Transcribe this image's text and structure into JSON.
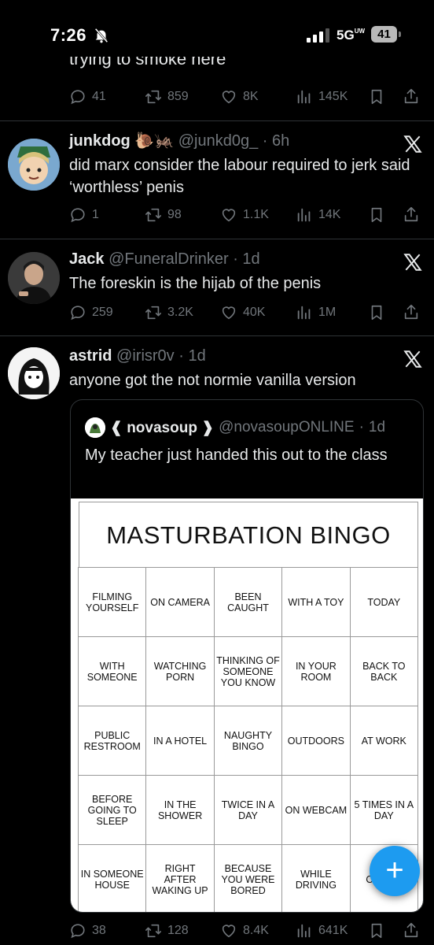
{
  "status": {
    "time": "7:26",
    "network": "5G",
    "network_sup": "UW",
    "battery": "41"
  },
  "prev_tweet": {
    "text_tail": "trying to smoke here",
    "replies": "41",
    "retweets": "859",
    "likes": "8K",
    "views": "145K"
  },
  "tweets": [
    {
      "name": "junkdog",
      "emoji": "🐌🦗",
      "handle": "@junkd0g_",
      "time": "6h",
      "text": "did marx consider the labour required to jerk said ‘worthless’ penis",
      "replies": "1",
      "retweets": "98",
      "likes": "1.1K",
      "views": "14K"
    },
    {
      "name": "Jack",
      "handle": "@FuneralDrinker",
      "time": "1d",
      "text": "The foreskin is the hijab of the penis",
      "replies": "259",
      "retweets": "3.2K",
      "likes": "40K",
      "views": "1M"
    },
    {
      "name": "astrid",
      "handle": "@irisr0v",
      "time": "1d",
      "text": "anyone got the not normie vanilla version",
      "replies": "38",
      "retweets": "128",
      "likes": "8.4K",
      "views": "641K"
    }
  ],
  "quote": {
    "name": "❰ novasoup ❱",
    "handle": "@novasoupONLINE",
    "time": "1d",
    "text": "My teacher just handed this out to the class"
  },
  "bingo": {
    "title": "MASTURBATION BINGO",
    "cells": [
      "FILMING YOURSELF",
      "ON CAMERA",
      "BEEN CAUGHT",
      "WITH A TOY",
      "TODAY",
      "WITH SOMEONE",
      "WATCHING PORN",
      "THINKING OF SOMEONE YOU KNOW",
      "IN YOUR ROOM",
      "BACK TO BACK",
      "PUBLIC RESTROOM",
      "IN A HOTEL",
      "NAUGHTY BINGO",
      "OUTDOORS",
      "AT WORK",
      "BEFORE GOING TO SLEEP",
      "IN THE SHOWER",
      "TWICE IN A DAY",
      "ON WEBCAM",
      "5 TIMES IN A DAY",
      "IN SOMEONE HOUSE",
      "RIGHT AFTER WAKING UP",
      "BECAUSE YOU WERE BORED",
      "WHILE DRIVING",
      "O… F…"
    ]
  },
  "colors": {
    "accent": "#1d9bf0",
    "muted": "#71767b",
    "divider": "#2f3336"
  }
}
